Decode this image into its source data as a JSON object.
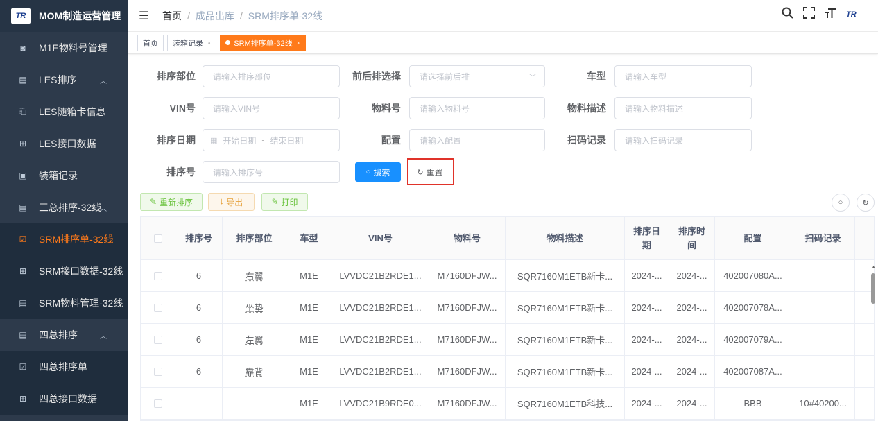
{
  "app": {
    "logo": "TR",
    "title": "MOM制造运营管理"
  },
  "sidebar": {
    "items": [
      {
        "label": "M1E物料号管理",
        "icon": "◙"
      },
      {
        "label": "LES排序",
        "icon": "▤",
        "arrow": "︿"
      },
      {
        "label": "LES随箱卡信息",
        "icon": "⎗"
      },
      {
        "label": "LES接口数据",
        "icon": "⊞"
      },
      {
        "label": "装箱记录",
        "icon": "▣"
      },
      {
        "label": "三总排序-32线",
        "icon": "▤",
        "arrow": "︿"
      },
      {
        "label": "SRM排序单-32线",
        "icon": "☑"
      },
      {
        "label": "SRM接口数据-32线",
        "icon": "⊞"
      },
      {
        "label": "SRM物料管理-32线",
        "icon": "▤"
      },
      {
        "label": "四总排序",
        "icon": "▤",
        "arrow": "︿"
      },
      {
        "label": "四总排序单",
        "icon": "☑"
      },
      {
        "label": "四总接口数据",
        "icon": "⊞"
      }
    ]
  },
  "header": {
    "breadcrumb": [
      "首页",
      "成品出库",
      "SRM排序单-32线"
    ],
    "sep": "/",
    "avatar": "TR"
  },
  "tags": [
    {
      "label": "首页"
    },
    {
      "label": "装箱记录",
      "close": "×"
    },
    {
      "label": "SRM排序单-32线",
      "close": "×"
    }
  ],
  "form": {
    "sort_dept": {
      "label": "排序部位",
      "placeholder": "请输入排序部位"
    },
    "front_back": {
      "label": "前后排选择",
      "placeholder": "请选择前后排"
    },
    "car_type": {
      "label": "车型",
      "placeholder": "请输入车型"
    },
    "vin": {
      "label": "VIN号",
      "placeholder": "请输入VIN号"
    },
    "material_no": {
      "label": "物料号",
      "placeholder": "请输入物料号"
    },
    "material_desc": {
      "label": "物料描述",
      "placeholder": "请输入物料描述"
    },
    "sort_date": {
      "label": "排序日期",
      "start": "开始日期",
      "dash": "-",
      "end": "结束日期"
    },
    "config": {
      "label": "配置",
      "placeholder": "请输入配置"
    },
    "scan": {
      "label": "扫码记录",
      "placeholder": "请输入扫码记录"
    },
    "sort_no": {
      "label": "排序号",
      "placeholder": "请输入排序号"
    },
    "search_btn": "搜索",
    "reset_btn": "重置"
  },
  "toolbar": {
    "resort": "重新排序",
    "export": "导出",
    "print": "打印"
  },
  "table": {
    "headers": [
      "排序号",
      "排序部位",
      "车型",
      "VIN号",
      "物料号",
      "物料描述",
      "排序日期",
      "排序时间",
      "配置",
      "扫码记录"
    ],
    "rows": [
      [
        "6",
        "右翼",
        "M1E",
        "LVVDC21B2RDE1...",
        "M7160DFJW...",
        "SQR7160M1ETB新卡...",
        "2024-...",
        "2024-...",
        "402007080A...",
        ""
      ],
      [
        "6",
        "坐垫",
        "M1E",
        "LVVDC21B2RDE1...",
        "M7160DFJW...",
        "SQR7160M1ETB新卡...",
        "2024-...",
        "2024-...",
        "402007078A...",
        ""
      ],
      [
        "6",
        "左翼",
        "M1E",
        "LVVDC21B2RDE1...",
        "M7160DFJW...",
        "SQR7160M1ETB新卡...",
        "2024-...",
        "2024-...",
        "402007079A...",
        ""
      ],
      [
        "6",
        "靠背",
        "M1E",
        "LVVDC21B2RDE1...",
        "M7160DFJW...",
        "SQR7160M1ETB新卡...",
        "2024-...",
        "2024-...",
        "402007087A...",
        ""
      ],
      [
        "",
        "",
        "M1E",
        "LVVDC21B9RDE0...",
        "M7160DFJW...",
        "SQR7160M1ETB科技...",
        "2024-...",
        "2024-...",
        "BBB",
        "10#40200..."
      ]
    ]
  },
  "colors": {
    "sidebar_bg": "#2d3a4b",
    "accent": "#ff7a1a",
    "primary": "#1890ff",
    "highlight": "#e0332a"
  }
}
